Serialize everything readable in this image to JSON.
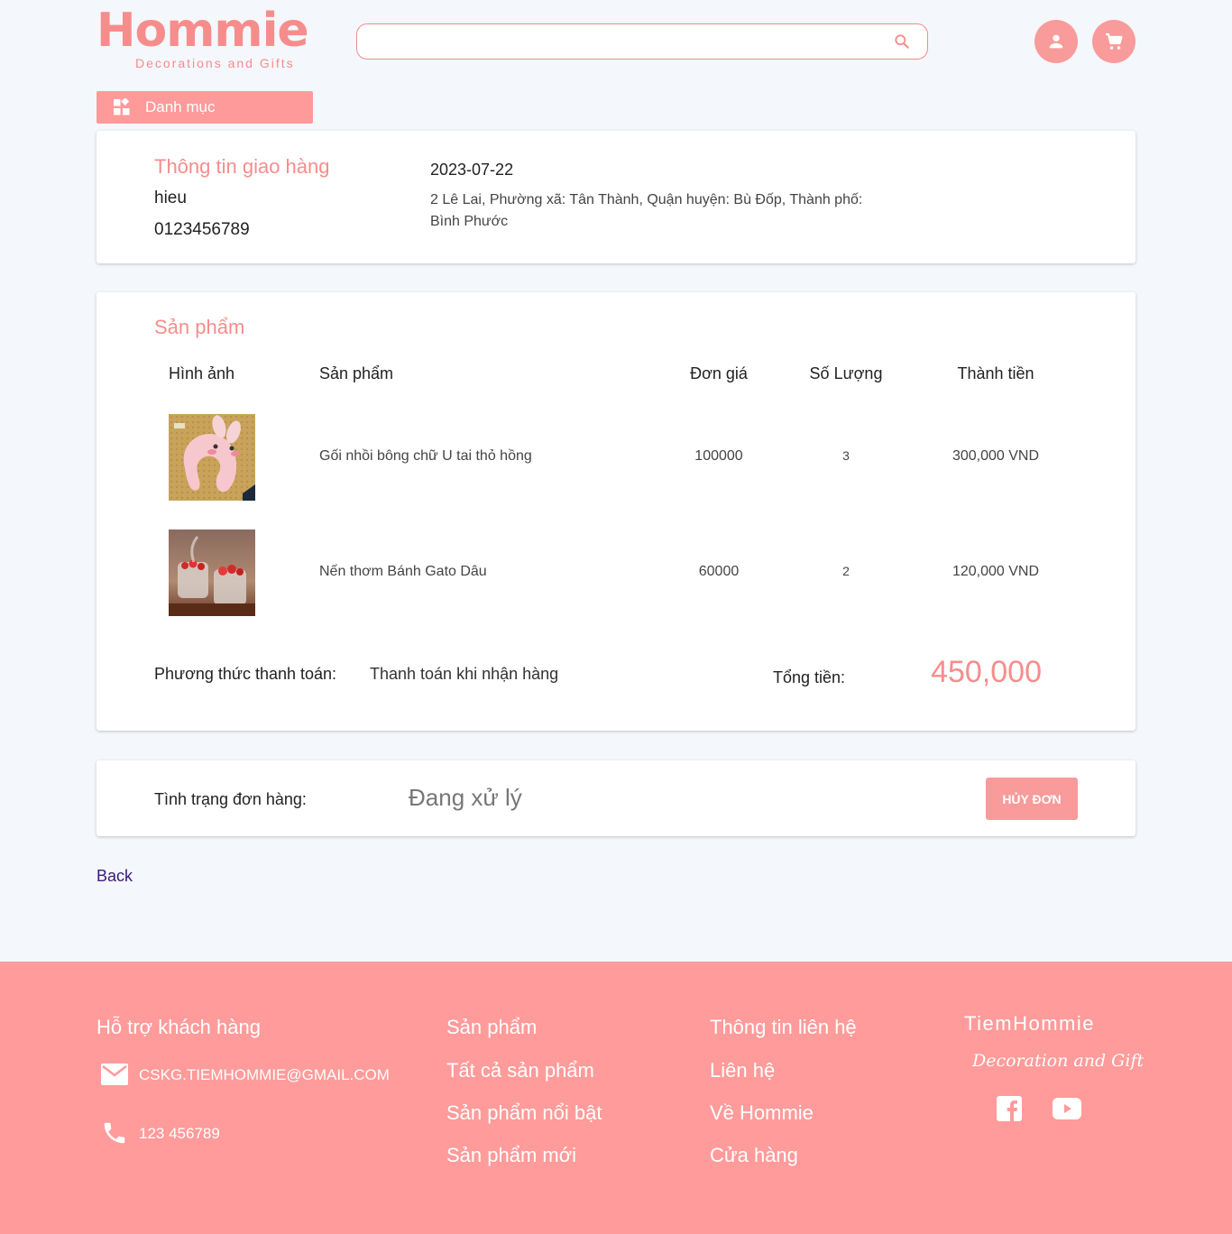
{
  "brand": {
    "name": "Hommie",
    "tagline": "Decorations and Gifts"
  },
  "search": {
    "placeholder": ""
  },
  "icons": {
    "search": "search-icon",
    "user": "user-icon",
    "cart": "cart-icon",
    "category": "grid-icon"
  },
  "colors": {
    "accent": "#f68d8c",
    "footer_bg": "#ff9b9a",
    "background": "#f4f7fb"
  },
  "nav": {
    "category_label": "Danh mục"
  },
  "shipping": {
    "title": "Thông tin giao hàng",
    "name": "hieu",
    "phone": "0123456789",
    "date": "2023-07-22",
    "address": "2 Lê Lai, Phường xã: Tân Thành, Quận huyện: Bù Đốp, Thành phố: Bình Phước"
  },
  "products": {
    "title": "Sản phẩm",
    "headers": {
      "image": "Hình ảnh",
      "product": "Sản phẩm",
      "unit_price": "Đơn giá",
      "quantity": "Số Lượng",
      "total": "Thành tiền"
    },
    "rows": [
      {
        "name": "Gối nhồi bông chữ U tai thỏ hồng",
        "unit_price": "100000",
        "quantity": "3",
        "total": "300,000 VND"
      },
      {
        "name": "Nến thơm Bánh Gato Dâu",
        "unit_price": "60000",
        "quantity": "2",
        "total": "120,000 VND"
      }
    ],
    "payment_label": "Phương thức thanh toán:",
    "payment_value": "Thanh toán khi nhận hàng",
    "total_label": "Tổng tiền:",
    "total_value": "450,000"
  },
  "status": {
    "label": "Tình trạng đơn hàng:",
    "value": "Đang xử lý",
    "cancel_label": "HỦY ĐƠN"
  },
  "back_label": "Back",
  "footer": {
    "support": {
      "title": "Hỗ trợ khách hàng",
      "email": "CSKG.TIEMHOMMIE@GMAIL.COM",
      "phone": "123 456789"
    },
    "products": {
      "title": "Sản phẩm",
      "links": [
        "Tất cả sản phẩm",
        "Sản phẩm nổi bật",
        "Sản phẩm mới"
      ]
    },
    "contact": {
      "title": "Thông tin liên hệ",
      "links": [
        "Liên hệ",
        "Về Hommie",
        "Cửa hàng"
      ]
    },
    "brand": {
      "name": "TiemHommie",
      "tagline": "Decoration and Gift"
    }
  }
}
